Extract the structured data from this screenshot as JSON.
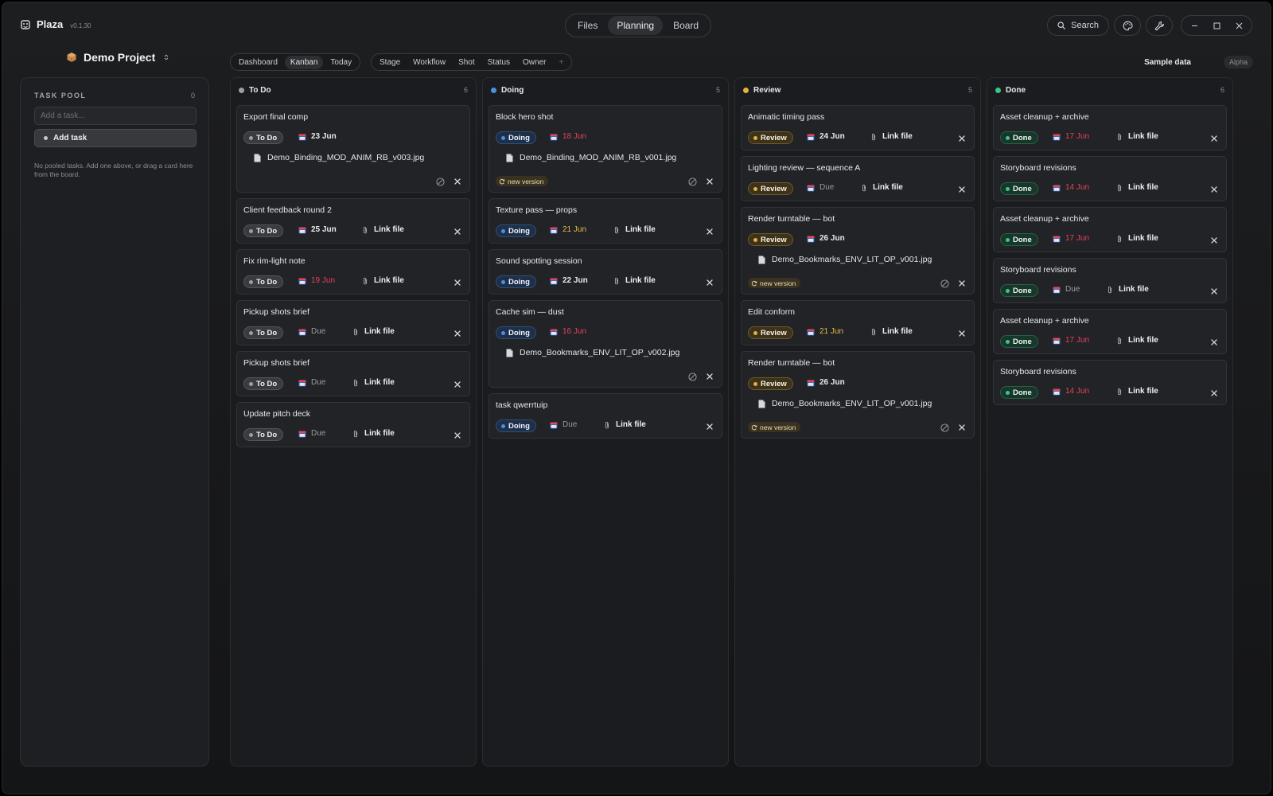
{
  "app": {
    "name": "Plaza",
    "version": "v0.1.30"
  },
  "view_tabs": [
    "Files",
    "Planning",
    "Board"
  ],
  "active_view": "Planning",
  "search_label": "Search",
  "project": {
    "name": "Demo Project"
  },
  "mode_tabs": [
    "Dashboard",
    "Kanban",
    "Today"
  ],
  "active_mode": "Kanban",
  "group_tabs": [
    "Stage",
    "Workflow",
    "Shot",
    "Status",
    "Owner"
  ],
  "group_add": "+",
  "sample_data_label": "Sample data",
  "alpha_label": "Alpha",
  "task_pool": {
    "title": "TASK POOL",
    "count": "0",
    "input_placeholder": "Add a task...",
    "add_label": "Add task",
    "empty_text": "No pooled tasks. Add one above, or drag a card here from the board."
  },
  "link_label": "Link file",
  "new_version_label": "new version",
  "colors": {
    "todo": "#9d9ea4",
    "doing": "#4a90e2",
    "review": "#e0b23e",
    "done": "#3ec585",
    "overdue": "#e3435c",
    "soon": "#e6b94a"
  },
  "columns": [
    {
      "title": "To Do",
      "count": "6",
      "status": "todo",
      "cards": [
        {
          "title": "Export final comp",
          "status": "To Do",
          "date": "23 Jun",
          "date_state": "normal",
          "file": "Demo_Binding_MOD_ANIM_RB_v003.jpg",
          "actions": true
        },
        {
          "title": "Client feedback round 2",
          "status": "To Do",
          "date": "25 Jun",
          "date_state": "normal"
        },
        {
          "title": "Fix rim-light note",
          "status": "To Do",
          "date": "19 Jun",
          "date_state": "overdue"
        },
        {
          "title": "Pickup shots brief",
          "status": "To Do",
          "date": "Due",
          "date_state": "muted"
        },
        {
          "title": "Pickup shots brief",
          "status": "To Do",
          "date": "Due",
          "date_state": "muted"
        },
        {
          "title": "Update pitch deck",
          "status": "To Do",
          "date": "Due",
          "date_state": "muted"
        }
      ]
    },
    {
      "title": "Doing",
      "count": "5",
      "status": "doing",
      "cards": [
        {
          "title": "Block hero shot",
          "status": "Doing",
          "date": "18 Jun",
          "date_state": "overdue",
          "file": "Demo_Binding_MOD_ANIM_RB_v001.jpg",
          "new_version": true,
          "actions": true
        },
        {
          "title": "Texture pass — props",
          "status": "Doing",
          "date": "21 Jun",
          "date_state": "soon"
        },
        {
          "title": "Sound spotting session",
          "status": "Doing",
          "date": "22 Jun",
          "date_state": "normal"
        },
        {
          "title": "Cache sim — dust",
          "status": "Doing",
          "date": "16 Jun",
          "date_state": "overdue",
          "file": "Demo_Bookmarks_ENV_LIT_OP_v002.jpg",
          "actions": true
        },
        {
          "title": "task qwerrtuip",
          "status": "Doing",
          "date": "Due",
          "date_state": "muted"
        }
      ]
    },
    {
      "title": "Review",
      "count": "5",
      "status": "review",
      "cards": [
        {
          "title": "Animatic timing pass",
          "status": "Review",
          "date": "24 Jun",
          "date_state": "normal"
        },
        {
          "title": "Lighting review — sequence A",
          "status": "Review",
          "date": "Due",
          "date_state": "muted"
        },
        {
          "title": "Render turntable — bot",
          "status": "Review",
          "date": "26 Jun",
          "date_state": "normal",
          "file": "Demo_Bookmarks_ENV_LIT_OP_v001.jpg",
          "new_version": true,
          "actions": true
        },
        {
          "title": "Edit conform",
          "status": "Review",
          "date": "21 Jun",
          "date_state": "soon"
        },
        {
          "title": "Render turntable — bot",
          "status": "Review",
          "date": "26 Jun",
          "date_state": "normal",
          "file": "Demo_Bookmarks_ENV_LIT_OP_v001.jpg",
          "new_version": true,
          "actions": true
        }
      ]
    },
    {
      "title": "Done",
      "count": "6",
      "status": "done",
      "cards": [
        {
          "title": "Asset cleanup + archive",
          "status": "Done",
          "date": "17 Jun",
          "date_state": "overdue"
        },
        {
          "title": "Storyboard revisions",
          "status": "Done",
          "date": "14 Jun",
          "date_state": "overdue"
        },
        {
          "title": "Asset cleanup + archive",
          "status": "Done",
          "date": "17 Jun",
          "date_state": "overdue"
        },
        {
          "title": "Storyboard revisions",
          "status": "Done",
          "date": "Due",
          "date_state": "muted"
        },
        {
          "title": "Asset cleanup + archive",
          "status": "Done",
          "date": "17 Jun",
          "date_state": "overdue"
        },
        {
          "title": "Storyboard revisions",
          "status": "Done",
          "date": "14 Jun",
          "date_state": "overdue"
        }
      ]
    }
  ]
}
